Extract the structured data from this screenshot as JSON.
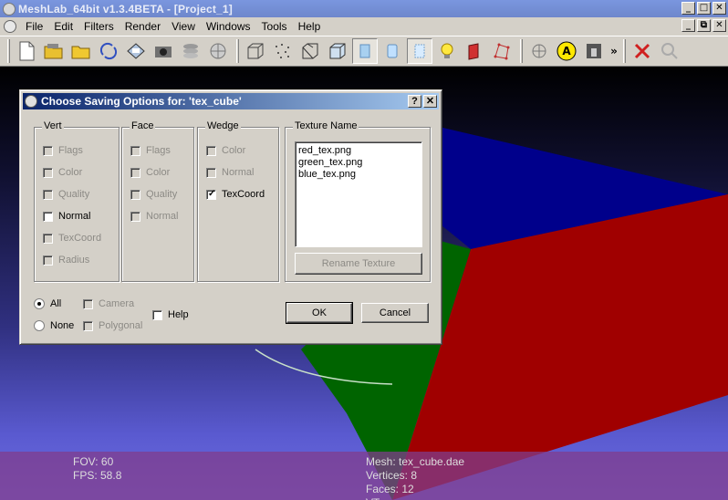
{
  "window": {
    "title": "MeshLab_64bit v1.3.4BETA - [Project_1]",
    "buttons": [
      "_",
      "□",
      "✕"
    ]
  },
  "menubar": {
    "items": [
      "File",
      "Edit",
      "Filters",
      "Render",
      "View",
      "Windows",
      "Tools",
      "Help"
    ],
    "mdi_buttons": [
      "_",
      "⧉",
      "✕"
    ]
  },
  "toolbar": {
    "icons": [
      "new-doc-icon",
      "open-project-icon",
      "open-folder-icon",
      "reload-icon",
      "save-icon",
      "snapshot-icon",
      "layers-icon",
      "mesh-sphere-icon",
      "bbox-icon",
      "points-icon",
      "wireframe-icon",
      "hidden-lines-icon",
      "flat-icon",
      "smooth-icon",
      "texture-icon",
      "light-icon",
      "color-icon",
      "vertex-select-icon",
      "align-icon",
      "annotate-icon",
      "measure-icon",
      "cross-icon",
      "search-icon"
    ],
    "more": "»"
  },
  "dialog": {
    "title": "Choose Saving Options for: 'tex_cube'",
    "help_btn": "?",
    "close_btn": "✕",
    "vert": {
      "title": "Vert",
      "items": [
        {
          "label": "Flags",
          "checked": false,
          "enabled": false
        },
        {
          "label": "Color",
          "checked": false,
          "enabled": false
        },
        {
          "label": "Quality",
          "checked": false,
          "enabled": false
        },
        {
          "label": "Normal",
          "checked": false,
          "enabled": true
        },
        {
          "label": "TexCoord",
          "checked": false,
          "enabled": false
        },
        {
          "label": "Radius",
          "checked": false,
          "enabled": false
        }
      ]
    },
    "face": {
      "title": "Face",
      "items": [
        {
          "label": "Flags",
          "checked": false,
          "enabled": false
        },
        {
          "label": "Color",
          "checked": false,
          "enabled": false
        },
        {
          "label": "Quality",
          "checked": false,
          "enabled": false
        },
        {
          "label": "Normal",
          "checked": false,
          "enabled": false
        }
      ]
    },
    "wedge": {
      "title": "Wedge",
      "items": [
        {
          "label": "Color",
          "checked": false,
          "enabled": false
        },
        {
          "label": "Normal",
          "checked": false,
          "enabled": false
        },
        {
          "label": "TexCoord",
          "checked": true,
          "enabled": true
        }
      ]
    },
    "texture": {
      "title": "Texture Name",
      "files": [
        "red_tex.png",
        "green_tex.png",
        "blue_tex.png"
      ],
      "rename_label": "Rename Texture"
    },
    "options": {
      "all": "All",
      "none": "None",
      "camera": "Camera",
      "polygonal": "Polygonal",
      "help": "Help"
    },
    "ok_label": "OK",
    "cancel_label": "Cancel"
  },
  "info": {
    "fov": "FOV: 60",
    "fps": "FPS:    58.8",
    "mesh": "Mesh: tex_cube.dae",
    "vertices": "Vertices: 8",
    "faces": "Faces: 12",
    "extra": "VT"
  }
}
